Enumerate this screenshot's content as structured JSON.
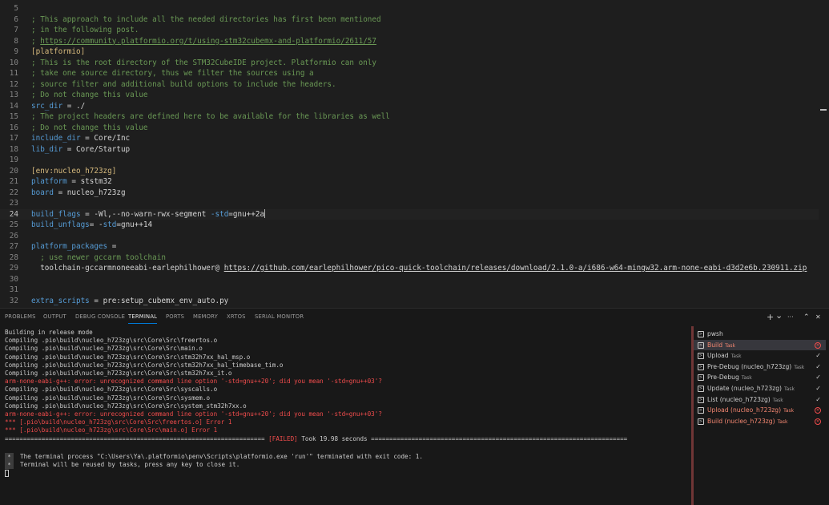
{
  "editor": {
    "lines": [
      {
        "n": "5",
        "tokens": []
      },
      {
        "n": "6",
        "tokens": [
          {
            "c": "comment",
            "t": "; This approach to include all the needed directories has first been mentioned"
          }
        ]
      },
      {
        "n": "7",
        "tokens": [
          {
            "c": "comment",
            "t": "; in the following post."
          }
        ]
      },
      {
        "n": "8",
        "tokens": [
          {
            "c": "comment",
            "t": "; "
          },
          {
            "c": "link",
            "t": "https://community.platformio.org/t/using-stm32cubemx-and-platformio/2611/57"
          }
        ]
      },
      {
        "n": "9",
        "tokens": [
          {
            "c": "section",
            "t": "[platformio]"
          }
        ]
      },
      {
        "n": "10",
        "tokens": [
          {
            "c": "comment",
            "t": "; This is the root directory of the STM32CubeIDE project. Platformio can only"
          }
        ]
      },
      {
        "n": "11",
        "tokens": [
          {
            "c": "comment",
            "t": "; take one source directory, thus we filter the sources using a"
          }
        ]
      },
      {
        "n": "12",
        "tokens": [
          {
            "c": "comment",
            "t": "; source filter and additional build options to include the headers."
          }
        ]
      },
      {
        "n": "13",
        "tokens": [
          {
            "c": "comment",
            "t": "; Do not change this value"
          }
        ]
      },
      {
        "n": "14",
        "tokens": [
          {
            "c": "key",
            "t": "src_dir"
          },
          {
            "c": "op",
            "t": " = "
          },
          {
            "c": "val",
            "t": "./"
          }
        ]
      },
      {
        "n": "15",
        "tokens": [
          {
            "c": "comment",
            "t": "; The project headers are defined here to be available for the libraries as well"
          }
        ]
      },
      {
        "n": "16",
        "tokens": [
          {
            "c": "comment",
            "t": "; Do not change this value"
          }
        ]
      },
      {
        "n": "17",
        "tokens": [
          {
            "c": "key",
            "t": "include_dir"
          },
          {
            "c": "op",
            "t": " = "
          },
          {
            "c": "val",
            "t": "Core/Inc"
          }
        ]
      },
      {
        "n": "18",
        "tokens": [
          {
            "c": "key",
            "t": "lib_dir"
          },
          {
            "c": "op",
            "t": " = "
          },
          {
            "c": "val",
            "t": "Core/Startup"
          }
        ]
      },
      {
        "n": "19",
        "tokens": []
      },
      {
        "n": "20",
        "tokens": [
          {
            "c": "section",
            "t": "[env:nucleo_h723zg]"
          }
        ]
      },
      {
        "n": "21",
        "tokens": [
          {
            "c": "key",
            "t": "platform"
          },
          {
            "c": "op",
            "t": " = "
          },
          {
            "c": "val",
            "t": "ststm32"
          }
        ]
      },
      {
        "n": "22",
        "tokens": [
          {
            "c": "key",
            "t": "board"
          },
          {
            "c": "op",
            "t": " = "
          },
          {
            "c": "val",
            "t": "nucleo_h723zg"
          }
        ]
      },
      {
        "n": "23",
        "tokens": []
      },
      {
        "n": "24",
        "current": true,
        "tokens": [
          {
            "c": "key",
            "t": "build_flags"
          },
          {
            "c": "op",
            "t": " = "
          },
          {
            "c": "val",
            "t": "-Wl,--no-warn-rwx-segment "
          },
          {
            "c": "key",
            "t": "-std"
          },
          {
            "c": "val",
            "t": "=gnu++2a"
          }
        ]
      },
      {
        "n": "25",
        "tokens": [
          {
            "c": "key",
            "t": "build_unflags"
          },
          {
            "c": "op",
            "t": "= "
          },
          {
            "c": "val",
            "t": "-"
          },
          {
            "c": "key",
            "t": "std"
          },
          {
            "c": "val",
            "t": "=gnu++14"
          }
        ]
      },
      {
        "n": "26",
        "tokens": []
      },
      {
        "n": "27",
        "tokens": [
          {
            "c": "key",
            "t": "platform_packages"
          },
          {
            "c": "op",
            "t": " ="
          }
        ]
      },
      {
        "n": "28",
        "tokens": [
          {
            "c": "comment",
            "t": "  ; use newer gccarm toolchain"
          }
        ]
      },
      {
        "n": "29",
        "tokens": [
          {
            "c": "val",
            "t": "  toolchain-gccarmnoneeabi-earlephilhower@ "
          },
          {
            "c": "link2",
            "t": "https://github.com/earlephilhower/pico-quick-toolchain/releases/download/2.1.0-a/i686-w64-mingw32.arm-none-eabi-d3d2e6b.230911.zip"
          }
        ]
      },
      {
        "n": "30",
        "tokens": []
      },
      {
        "n": "31",
        "tokens": []
      },
      {
        "n": "32",
        "tokens": [
          {
            "c": "key",
            "t": "extra_scripts"
          },
          {
            "c": "op",
            "t": " = "
          },
          {
            "c": "val",
            "t": "pre:setup_cubemx_env_auto.py"
          }
        ]
      }
    ]
  },
  "panel": {
    "tabs": [
      {
        "label": "PROBLEMS",
        "name": "tab-problems"
      },
      {
        "label": "OUTPUT",
        "name": "tab-output"
      },
      {
        "label": "DEBUG CONSOLE",
        "name": "tab-debug-console"
      },
      {
        "label": "TERMINAL",
        "name": "tab-terminal",
        "active": true
      },
      {
        "label": "PORTS",
        "name": "tab-ports"
      },
      {
        "label": "MEMORY",
        "name": "tab-memory"
      },
      {
        "label": "XRTOS",
        "name": "tab-xrtos"
      },
      {
        "label": "SERIAL MONITOR",
        "name": "tab-serial-monitor"
      }
    ],
    "actions": {
      "add": "+",
      "dropdown": "⌄",
      "more": "···",
      "maximize": "⌃",
      "close": "✕"
    }
  },
  "terminal": {
    "lines": [
      {
        "t": "Building in release mode"
      },
      {
        "t": "Compiling .pio\\build\\nucleo_h723zg\\src\\Core\\Src\\freertos.o"
      },
      {
        "t": "Compiling .pio\\build\\nucleo_h723zg\\src\\Core\\Src\\main.o"
      },
      {
        "t": "Compiling .pio\\build\\nucleo_h723zg\\src\\Core\\Src\\stm32h7xx_hal_msp.o"
      },
      {
        "t": "Compiling .pio\\build\\nucleo_h723zg\\src\\Core\\Src\\stm32h7xx_hal_timebase_tim.o"
      },
      {
        "t": "Compiling .pio\\build\\nucleo_h723zg\\src\\Core\\Src\\stm32h7xx_it.o"
      },
      {
        "t": "arm-none-eabi-g++: error: unrecognized command line option '-std=gnu++20'; did you mean '-std=gnu++03'?",
        "err": true
      },
      {
        "t": "Compiling .pio\\build\\nucleo_h723zg\\src\\Core\\Src\\syscalls.o"
      },
      {
        "t": "Compiling .pio\\build\\nucleo_h723zg\\src\\Core\\Src\\sysmem.o"
      },
      {
        "t": "Compiling .pio\\build\\nucleo_h723zg\\src\\Core\\Src\\system_stm32h7xx.o"
      },
      {
        "t": "arm-none-eabi-g++: error: unrecognized command line option '-std=gnu++20'; did you mean '-std=gnu++03'?",
        "err": true
      },
      {
        "t": "*** [.pio\\build\\nucleo_h723zg\\src\\Core\\Src\\freertos.o] Error 1",
        "err": true
      },
      {
        "t": "*** [.pio\\build\\nucleo_h723zg\\src\\Core\\Src\\main.o] Error 1",
        "err": true
      }
    ],
    "summary": {
      "left": "======================================================================= ",
      "failed": "[FAILED]",
      "right": " Took 19.98 seconds ======================================================================"
    },
    "message_marker": "*",
    "message_lines": [
      "The terminal process \"C:\\Users\\Ya\\.platformio\\penv\\Scripts\\platformio.exe 'run'\" terminated with exit code: 1.",
      "Terminal will be reused by tasks, press any key to close it."
    ]
  },
  "tasks": [
    {
      "name": "pwsh",
      "sub": "",
      "status": "none"
    },
    {
      "name": "Build",
      "sub": "Task",
      "status": "error",
      "selected": true
    },
    {
      "name": "Upload",
      "sub": "Task",
      "status": "ok"
    },
    {
      "name": "Pre-Debug (nucleo_h723zg)",
      "sub": "Task",
      "status": "ok"
    },
    {
      "name": "Pre-Debug",
      "sub": "Task",
      "status": "ok"
    },
    {
      "name": "Update (nucleo_h723zg)",
      "sub": "Task",
      "status": "ok"
    },
    {
      "name": "List (nucleo_h723zg)",
      "sub": "Task",
      "status": "ok"
    },
    {
      "name": "Upload (nucleo_h723zg)",
      "sub": "Task",
      "status": "error"
    },
    {
      "name": "Build (nucleo_h723zg)",
      "sub": "Task",
      "status": "error"
    }
  ],
  "icons": {
    "terminal": "terminal-icon",
    "check": "check-icon",
    "error": "error-circle-icon"
  },
  "colors": {
    "error": "#f14c4c",
    "accent": "#0078d4",
    "comment": "#6a9955",
    "key": "#569cd6",
    "section": "#d7ba7d"
  }
}
